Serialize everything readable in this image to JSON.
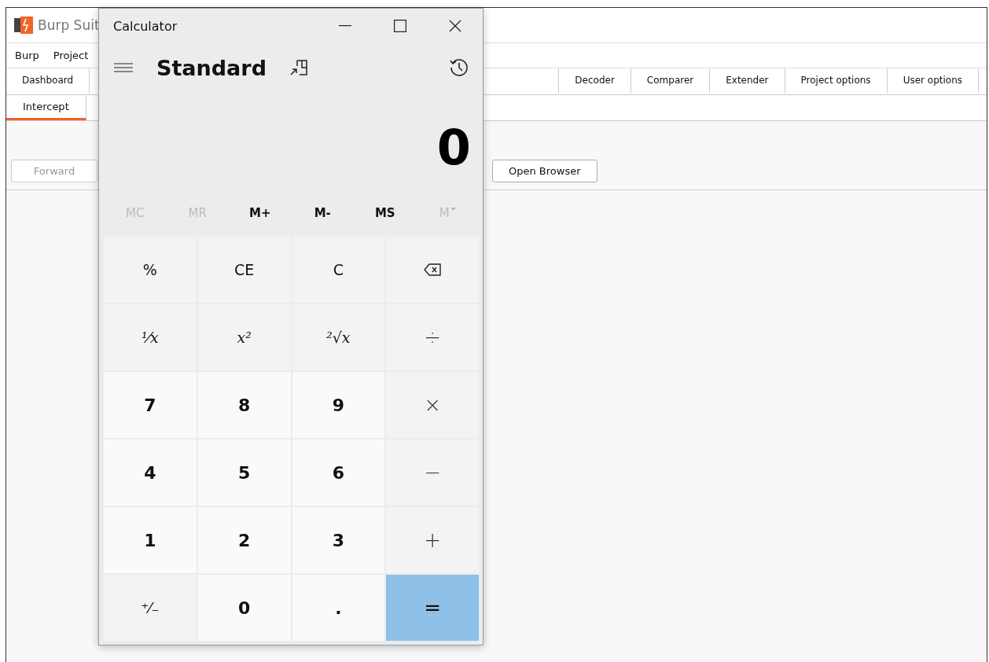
{
  "burp_window": {
    "title": "Burp Suit",
    "menu": [
      "Burp",
      "Project"
    ],
    "tabs_left": [
      {
        "label": "Dashboard",
        "selected": false
      }
    ],
    "tabs_right": [
      {
        "label": "Decoder",
        "selected": false
      },
      {
        "label": "Comparer",
        "selected": false
      },
      {
        "label": "Extender",
        "selected": false
      },
      {
        "label": "Project options",
        "selected": false
      },
      {
        "label": "User options",
        "selected": false
      }
    ],
    "subtabs": [
      {
        "label": "Intercept",
        "selected": true
      }
    ],
    "buttons": [
      {
        "label": "Forward",
        "disabled": true
      },
      {
        "label": "Open Browser",
        "disabled": false
      }
    ]
  },
  "calculator": {
    "title": "Calculator",
    "mode": "Standard",
    "display": "0",
    "memory": [
      {
        "label": "MC",
        "disabled": true,
        "kind": "text"
      },
      {
        "label": "MR",
        "disabled": true,
        "kind": "text"
      },
      {
        "label": "M+",
        "disabled": false,
        "kind": "text"
      },
      {
        "label": "M-",
        "disabled": false,
        "kind": "text"
      },
      {
        "label": "MS",
        "disabled": false,
        "kind": "text"
      },
      {
        "label": "M",
        "disabled": true,
        "kind": "dropdown"
      }
    ],
    "keys": [
      {
        "label": "%",
        "kind": "function"
      },
      {
        "label": "CE",
        "kind": "function"
      },
      {
        "label": "C",
        "kind": "function"
      },
      {
        "kind": "backspace"
      },
      {
        "label": "¹⁄x",
        "kind": "math"
      },
      {
        "label": "x²",
        "kind": "math"
      },
      {
        "label": "²√x",
        "kind": "math"
      },
      {
        "label": "÷",
        "kind": "operator"
      },
      {
        "label": "7",
        "kind": "digit"
      },
      {
        "label": "8",
        "kind": "digit"
      },
      {
        "label": "9",
        "kind": "digit"
      },
      {
        "label": "×",
        "kind": "operator"
      },
      {
        "label": "4",
        "kind": "digit"
      },
      {
        "label": "5",
        "kind": "digit"
      },
      {
        "label": "6",
        "kind": "digit"
      },
      {
        "label": "−",
        "kind": "operator"
      },
      {
        "label": "1",
        "kind": "digit"
      },
      {
        "label": "2",
        "kind": "digit"
      },
      {
        "label": "3",
        "kind": "digit"
      },
      {
        "label": "+",
        "kind": "operator"
      },
      {
        "label": "⁺⁄₋",
        "kind": "function"
      },
      {
        "label": "0",
        "kind": "digit"
      },
      {
        "label": ".",
        "kind": "digit"
      },
      {
        "label": "=",
        "kind": "equals"
      }
    ]
  }
}
